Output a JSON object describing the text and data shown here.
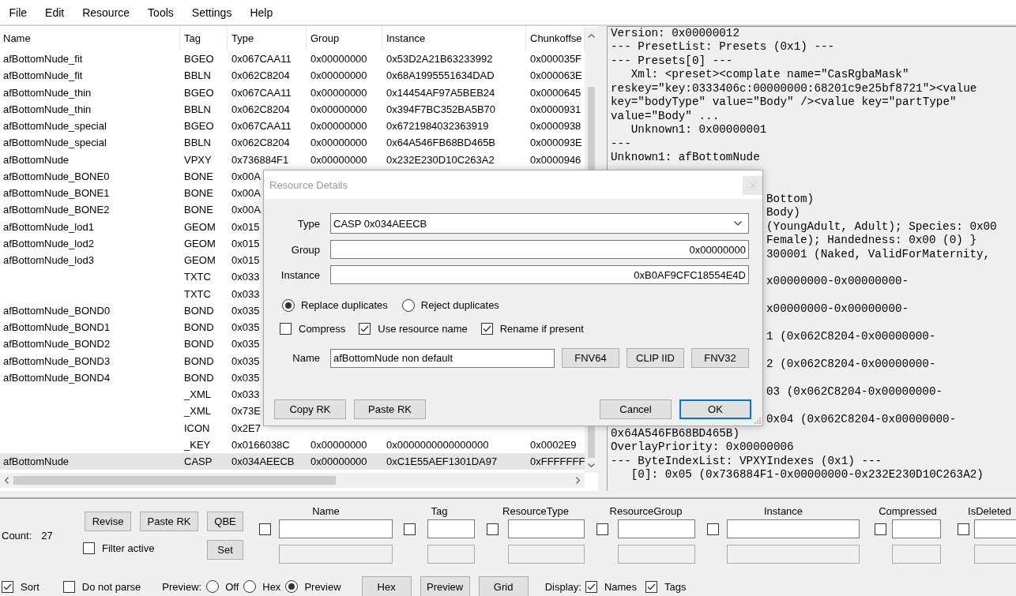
{
  "menu": [
    "File",
    "Edit",
    "Resource",
    "Tools",
    "Settings",
    "Help"
  ],
  "table": {
    "columns": [
      "Name",
      "Tag",
      "Type",
      "Group",
      "Instance",
      "Chunkoffse"
    ],
    "rows": [
      {
        "name": "afBottomNude_fit",
        "tag": "BGEO",
        "type": "0x067CAA11",
        "group": "0x00000000",
        "instance": "0x53D2A21B63233992",
        "chunkoffset": "0x000035F",
        "selected": false
      },
      {
        "name": "afBottomNude_fit",
        "tag": "BBLN",
        "type": "0x062C8204",
        "group": "0x00000000",
        "instance": "0x68A1995551634DAD",
        "chunkoffset": "0x000063E",
        "selected": false
      },
      {
        "name": "afBottomNude_thin",
        "tag": "BGEO",
        "type": "0x067CAA11",
        "group": "0x00000000",
        "instance": "0x14454AF97A5BEB24",
        "chunkoffset": "0x0000645",
        "selected": false
      },
      {
        "name": "afBottomNude_thin",
        "tag": "BBLN",
        "type": "0x062C8204",
        "group": "0x00000000",
        "instance": "0x394F7BC352BA5B70",
        "chunkoffset": "0x0000931",
        "selected": false
      },
      {
        "name": "afBottomNude_special",
        "tag": "BGEO",
        "type": "0x067CAA11",
        "group": "0x00000000",
        "instance": "0x6721984032363919",
        "chunkoffset": "0x0000938",
        "selected": false
      },
      {
        "name": "afBottomNude_special",
        "tag": "BBLN",
        "type": "0x062C8204",
        "group": "0x00000000",
        "instance": "0x64A546FB68BD465B",
        "chunkoffset": "0x000093E",
        "selected": false
      },
      {
        "name": "afBottomNude",
        "tag": "VPXY",
        "type": "0x736884F1",
        "group": "0x00000000",
        "instance": "0x232E230D10C263A2",
        "chunkoffset": "0x0000946",
        "selected": false
      },
      {
        "name": "afBottomNude_BONE0",
        "tag": "BONE",
        "type": "0x00A",
        "selected": false
      },
      {
        "name": "afBottomNude_BONE1",
        "tag": "BONE",
        "type": "0x00A",
        "selected": false
      },
      {
        "name": "afBottomNude_BONE2",
        "tag": "BONE",
        "type": "0x00A",
        "selected": false
      },
      {
        "name": "afBottomNude_lod1",
        "tag": "GEOM",
        "type": "0x015",
        "selected": false
      },
      {
        "name": "afBottomNude_lod2",
        "tag": "GEOM",
        "type": "0x015",
        "selected": false
      },
      {
        "name": "afBottomNude_lod3",
        "tag": "GEOM",
        "type": "0x015",
        "selected": false
      },
      {
        "tag": "TXTC",
        "type": "0x033",
        "selected": false
      },
      {
        "tag": "TXTC",
        "type": "0x033",
        "selected": false
      },
      {
        "name": "afBottomNude_BOND0",
        "tag": "BOND",
        "type": "0x035",
        "selected": false
      },
      {
        "name": "afBottomNude_BOND1",
        "tag": "BOND",
        "type": "0x035",
        "selected": false
      },
      {
        "name": "afBottomNude_BOND2",
        "tag": "BOND",
        "type": "0x035",
        "selected": false
      },
      {
        "name": "afBottomNude_BOND3",
        "tag": "BOND",
        "type": "0x035",
        "selected": false
      },
      {
        "name": "afBottomNude_BOND4",
        "tag": "BOND",
        "type": "0x035",
        "selected": false
      },
      {
        "tag": "_XML",
        "type": "0x033",
        "selected": false
      },
      {
        "tag": "_XML",
        "type": "0x73E",
        "selected": false
      },
      {
        "tag": "ICON",
        "type": "0x2E7",
        "selected": false
      },
      {
        "tag": "_KEY",
        "type": "0x0166038C",
        "group": "0x00000000",
        "instance": "0x0000000000000000",
        "chunkoffset": "0x0002E9",
        "selected": false
      },
      {
        "name": "afBottomNude",
        "tag": "CASP",
        "type": "0x034AEECB",
        "group": "0x00000000",
        "instance": "0xC1E55AEF1301DA97",
        "chunkoffset": "0xFFFFFFF",
        "selected": true
      }
    ]
  },
  "details_panel": {
    "lines": [
      "Version: 0x00000012",
      "--- PresetList: Presets (0x1) ---",
      "--- Presets[0] ---",
      "   Xml: <preset><complate name=\"CasRgbaMask\"",
      "reskey=\"key:0333406c:00000000:68201c9e25bf8721\"><value",
      "key=\"bodyType\" value=\"Body\" /><value key=\"partType\"",
      "value=\"Body\" ...",
      "   Unknown1: 0x00000001",
      "---",
      "Unknown1: afBottomNude"
    ],
    "covered_lines": [
      "Bottom)",
      "Body)",
      "(YoungAdult, Adult); Species: 0x00",
      "Female); Handedness: 0x00 (0) }"
    ],
    "wrapped_entries": [
      {
        "text": "300001 (Naked, ValidForMaternity,"
      },
      {
        "text": "x00000000-0x00000000-"
      },
      {
        "text": "x00000000-0x00000000-"
      },
      {
        "text": "1 (0x062C8204-0x00000000-"
      },
      {
        "text": "2 (0x062C8204-0x00000000-"
      },
      {
        "text": "03 (0x062C8204-0x00000000-"
      },
      {
        "text": "0x04 (0x062C8204-0x00000000-",
        "continuation": "0x64A546FB68BD465B)"
      }
    ],
    "lines_below": [
      "OverlayPriority: 0x00000006",
      "--- ByteIndexList: VPXYIndexes (0x1) ---",
      "   [0]: 0x05 (0x736884F1-0x00000000-0x232E230D10C263A2)"
    ]
  },
  "dialog": {
    "title": "Resource Details",
    "fields": [
      {
        "label": "Type",
        "kind": "combo",
        "value": "CASP 0x034AEECB"
      },
      {
        "label": "Group",
        "kind": "text",
        "value": "0x00000000"
      },
      {
        "label": "Instance",
        "kind": "text",
        "value": "0xB0AF9CFC18554E4D"
      }
    ],
    "duplicate_options": [
      {
        "label": "Replace duplicates",
        "selected": true
      },
      {
        "label": "Reject duplicates",
        "selected": false
      }
    ],
    "checkboxes": [
      {
        "label": "Compress",
        "checked": false
      },
      {
        "label": "Use resource name",
        "checked": true
      },
      {
        "label": "Rename if present",
        "checked": true
      }
    ],
    "name_field": {
      "label": "Name",
      "value": "afBottomNude non default"
    },
    "hash_buttons": [
      "FNV64",
      "CLIP IID",
      "FNV32"
    ],
    "left_buttons": [
      "Copy RK",
      "Paste RK"
    ],
    "right_buttons": [
      {
        "label": "Cancel",
        "focused": false
      },
      {
        "label": "OK",
        "focused": true
      }
    ]
  },
  "filter_panel": {
    "count_label": "Count:",
    "count": "27",
    "buttons": [
      "Revise",
      "Paste RK",
      "QBE"
    ],
    "filter_active": {
      "label": "Filter active",
      "checked": false
    },
    "set_button": "Set",
    "columns": [
      {
        "heading": "Name",
        "checked": false
      },
      {
        "heading": "Tag",
        "checked": false
      },
      {
        "heading": "ResourceType",
        "checked": false
      },
      {
        "heading": "ResourceGroup",
        "checked": false
      },
      {
        "heading": "Instance",
        "checked": false
      },
      {
        "heading": "Compressed",
        "checked": false
      },
      {
        "heading": "IsDeleted",
        "checked": false
      }
    ]
  },
  "options_bar": {
    "checkboxes": [
      {
        "label": "Sort",
        "checked": true
      },
      {
        "label": "Do not parse",
        "checked": false
      }
    ],
    "preview_label": "Preview:",
    "preview_options": [
      {
        "label": "Off",
        "selected": false
      },
      {
        "label": "Hex",
        "selected": false
      },
      {
        "label": "Preview",
        "selected": true
      }
    ],
    "view_buttons": [
      "Hex",
      "Preview",
      "Grid"
    ],
    "display_label": "Display:",
    "display_options": [
      {
        "label": "Names",
        "checked": true
      },
      {
        "label": "Tags",
        "checked": true
      }
    ]
  }
}
